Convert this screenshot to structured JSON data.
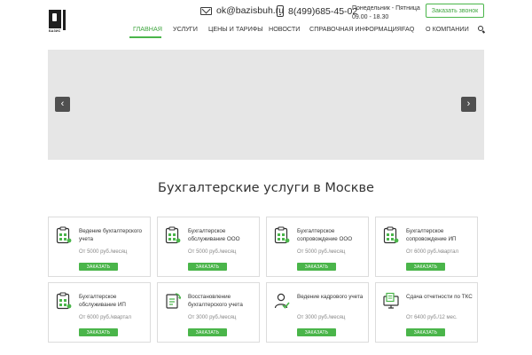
{
  "header": {
    "logo_text": "БАЗИС",
    "email": "ok@bazisbuh.ru",
    "phone": "8(499)685-45-02",
    "hours_days": "Понедельник - Пятница",
    "hours_time": "09.00 - 18.30",
    "callback_label": "Заказать звонок",
    "accent_color": "#4ab54a"
  },
  "nav": {
    "items": [
      {
        "label": "ГЛАВНАЯ",
        "active": true
      },
      {
        "label": "УСЛУГИ"
      },
      {
        "label": "ЦЕНЫ И ТАРИФЫ"
      },
      {
        "label": "НОВОСТИ"
      },
      {
        "label": "СПРАВОЧНАЯ ИНФОРМАЦИЯ"
      },
      {
        "label": "FAQ"
      },
      {
        "label": "О КОМПАНИИ"
      }
    ],
    "search_icon": "search-icon"
  },
  "slider": {
    "prev_glyph": "‹",
    "next_glyph": "›"
  },
  "services": {
    "title": "Бухгалтерские услуги в Москве",
    "cards": [
      {
        "title": "Ведение бухгалтерского учета",
        "price": "От 5000 руб./месяц",
        "button": "ЗАКАЗАТЬ",
        "icon": "clipboard-chart-icon"
      },
      {
        "title": "Бухгалтерское обслуживание ООО",
        "price": "От 5000 руб./месяц",
        "button": "ЗАКАЗАТЬ",
        "icon": "clipboard-chart-icon"
      },
      {
        "title": "Бухгалтерское сопровождение ООО",
        "price": "От 5000 руб./месяц",
        "button": "ЗАКАЗАТЬ",
        "icon": "clipboard-chart-icon"
      },
      {
        "title": "Бухгалтерское сопровождение ИП",
        "price": "От 6000 руб./квартал",
        "button": "ЗАКАЗАТЬ",
        "icon": "clipboard-chart-icon"
      },
      {
        "title": "Бухгалтерское обслуживание ИП",
        "price": "От 6000 руб./квартал",
        "button": "ЗАКАЗАТЬ",
        "icon": "clipboard-chart-icon"
      },
      {
        "title": "Восстановление бухгалтерского учета",
        "price": "От 3000 руб./месяц",
        "button": "ЗАКАЗАТЬ",
        "icon": "document-restore-icon"
      },
      {
        "title": "Ведение кадрового учета",
        "price": "От 3000 руб./месяц",
        "button": "ЗАКАЗАТЬ",
        "icon": "user-check-icon"
      },
      {
        "title": "Сдача отчетности по ТКС",
        "price": "От 6400 руб./12 мес.",
        "button": "ЗАКАЗАТЬ",
        "icon": "computer-report-icon"
      }
    ]
  }
}
